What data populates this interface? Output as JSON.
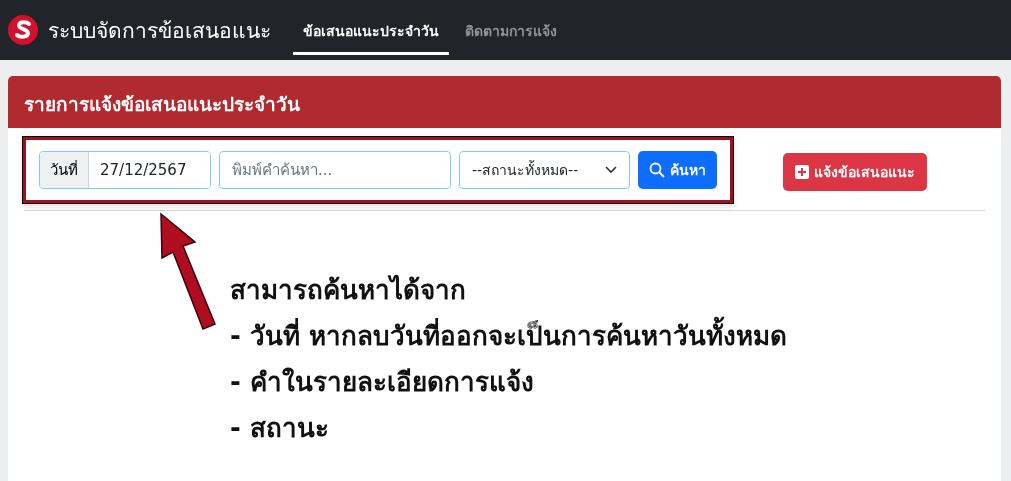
{
  "navbar": {
    "brand": "ระบบจัดการข้อเสนอแนะ",
    "tabs": [
      {
        "label": "ข้อเสนอแนะประจำวัน",
        "selected": true
      },
      {
        "label": "ติดตามการแจ้ง",
        "selected": false
      }
    ]
  },
  "card": {
    "title": "รายการแจ้งข้อเสนอแนะประจำวัน",
    "filters": {
      "date_label": "วันที่",
      "date_value": "27/12/2567",
      "search_placeholder": "พิมพ์คำค้นหา...",
      "status_select": "--สถานะทั้งหมด--",
      "search_button": "ค้นหา"
    },
    "add_button": "แจ้งข้อเสนอแนะ"
  },
  "annotation": {
    "lines": [
      "สามารถค้นหาได้จาก",
      "- วันที่ หากลบวันที่ออกจะเป็นการค้นหาวันทั้งหมด",
      "- คำในรายละเอียดการแจ้ง",
      "- สถานะ"
    ]
  }
}
